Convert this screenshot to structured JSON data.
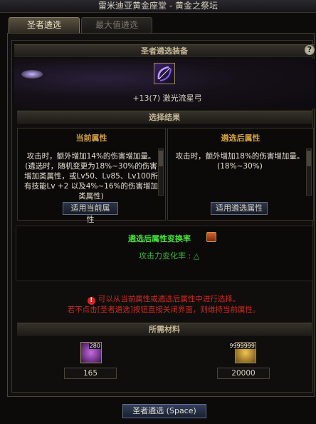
{
  "window": {
    "title": "雷米迪亚黄金座堂 - 黄金之祭坛"
  },
  "tabs": [
    {
      "label": "圣者遴选",
      "active": true
    },
    {
      "label": "最大值遴选",
      "active": false
    }
  ],
  "equipment": {
    "header": "圣者遴选装备",
    "help_icon": "?",
    "item_name": "+13(7) 激光流星弓"
  },
  "result": {
    "header": "选择结果",
    "current": {
      "title": "当前属性",
      "text": "攻击时，额外增加14%的伤害增加量。(遴选时，随机变更为18%~30%的伤害增加类属性，或Lv50、Lv85、Lv100所有技能Lv +2 以及4%~16%的伤害增加类属性)",
      "button": "适用当前属性"
    },
    "after": {
      "title": "遴选后属性",
      "text": "攻击时，额外增加18%的伤害增加量。(18%~30%)",
      "button": "适用遴选属性"
    }
  },
  "rate": {
    "title": "遴选后属性变换率",
    "line": "攻击力变化率 : △"
  },
  "warning": {
    "icon": "!",
    "line1": "可以从当前属性或遴选后属性中进行选择。",
    "line2": "若不点击[圣者遴选]按钮直接关闭界面，则维持当前属性。"
  },
  "materials": {
    "header": "所需材料",
    "items": [
      {
        "icon": "purple-crystal-icon",
        "stack": "280",
        "quantity": "165"
      },
      {
        "icon": "gold-coins-icon",
        "stack": "9999999",
        "quantity": "20000"
      }
    ]
  },
  "action": {
    "button": "圣者遴选 (Space)"
  },
  "colors": {
    "accent_gold": "#d6a23e",
    "rate_green": "#47e03b",
    "warning_red": "#cf2a23"
  }
}
